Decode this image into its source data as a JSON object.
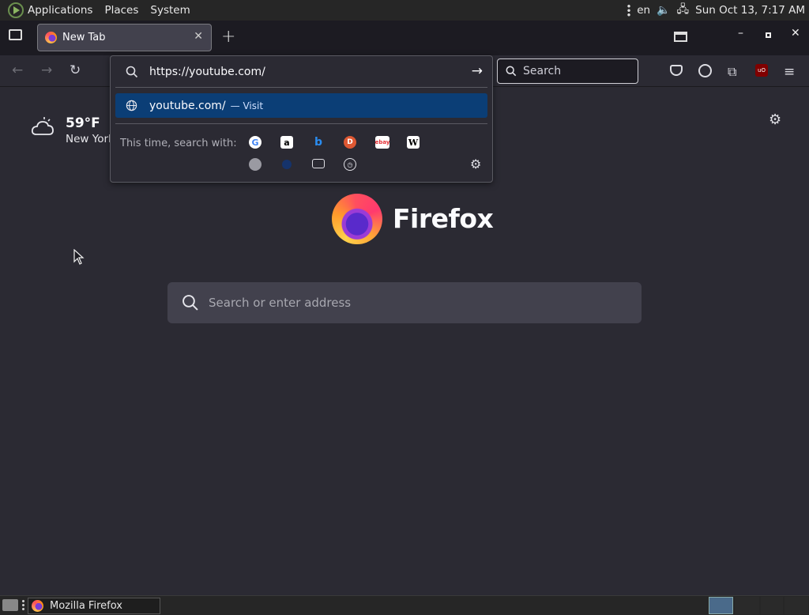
{
  "system": {
    "menus": [
      "Applications",
      "Places",
      "System"
    ],
    "lang": "en",
    "clock": "Sun Oct 13,  7:17 AM"
  },
  "tabs": [
    {
      "title": "New Tab",
      "close": "✕"
    }
  ],
  "urlbar": {
    "value": "https://youtube.com/",
    "suggestion": "youtube.com/",
    "suggestion_action": "— Visit",
    "engines_label": "This time, search with:",
    "engines": [
      {
        "name": "Google",
        "glyph": "G",
        "bg": "#ffffff",
        "fg": "#4285f4"
      },
      {
        "name": "Amazon",
        "glyph": "a",
        "bg": "#ffffff",
        "fg": "#000000"
      },
      {
        "name": "Bing",
        "glyph": "b",
        "bg": "transparent",
        "fg": "#2a8cf0"
      },
      {
        "name": "DuckDuckGo",
        "glyph": "D",
        "bg": "#de5833",
        "fg": "#ffffff"
      },
      {
        "name": "eBay",
        "glyph": "ebay",
        "bg": "#ffffff",
        "fg": "#e53238"
      },
      {
        "name": "Wikipedia",
        "glyph": "W",
        "bg": "#ffffff",
        "fg": "#000000"
      }
    ]
  },
  "search": {
    "placeholder": "Search"
  },
  "weather": {
    "temp": "59°F",
    "city": "New York"
  },
  "brand": {
    "name": "Firefox"
  },
  "main_search": {
    "placeholder": "Search or enter address"
  },
  "taskbar": {
    "window": "Mozilla Firefox"
  }
}
